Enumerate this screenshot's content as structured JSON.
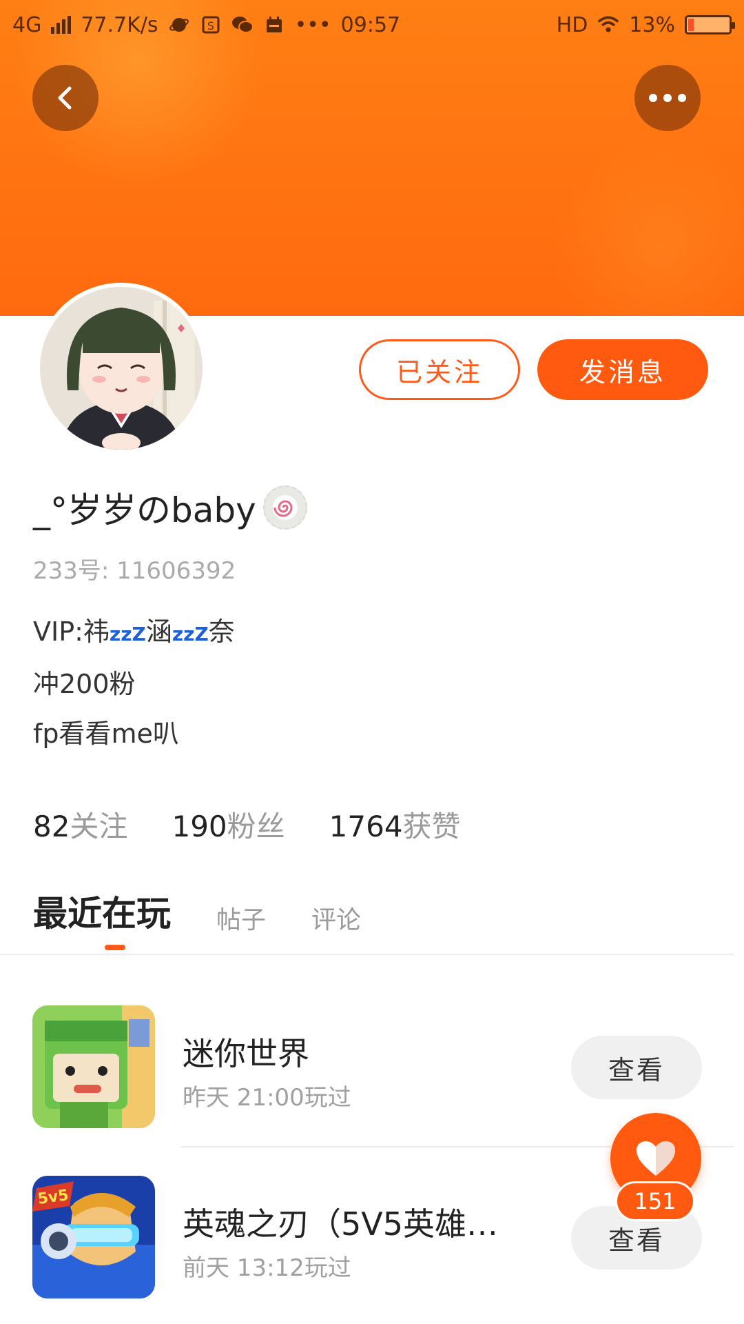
{
  "status_bar": {
    "network": "4G",
    "speed": "77.7K/s",
    "time": "09:57",
    "hd": "HD",
    "battery_text": "13%",
    "battery_level": 0.13
  },
  "header": {
    "back_icon": "chevron-left-icon",
    "more_icon": "more-horizontal-icon",
    "colors": {
      "primary": "#ff6a0f",
      "accent": "#ff5a1a"
    }
  },
  "profile": {
    "name": "_°岁岁のbaby",
    "uid": "233号: 11606392",
    "bio_prefix": "VIP:祎",
    "bio_zz1": "zzZ",
    "bio_mid": "涵",
    "bio_zz2": "zzZ",
    "bio_suffix": "奈",
    "bio_line2": "冲200粉",
    "bio_line3": "fp看看me叭"
  },
  "actions": {
    "followed_label": "已关注",
    "message_label": "发消息"
  },
  "stats": [
    {
      "num": "82",
      "label": "关注"
    },
    {
      "num": "190",
      "label": "粉丝"
    },
    {
      "num": "1764",
      "label": "获赞"
    }
  ],
  "tabs": [
    {
      "label": "最近在玩",
      "active": true
    },
    {
      "label": "帖子",
      "active": false
    },
    {
      "label": "评论",
      "active": false
    }
  ],
  "games": [
    {
      "name": "迷你世界",
      "time": "昨天 21:00玩过",
      "view_label": "查看"
    },
    {
      "name": "英魂之刃（5V5英雄…",
      "time": "前天 13:12玩过",
      "view_label": "查看"
    }
  ],
  "like_fab": {
    "count": "151",
    "icon": "heart-icon"
  }
}
